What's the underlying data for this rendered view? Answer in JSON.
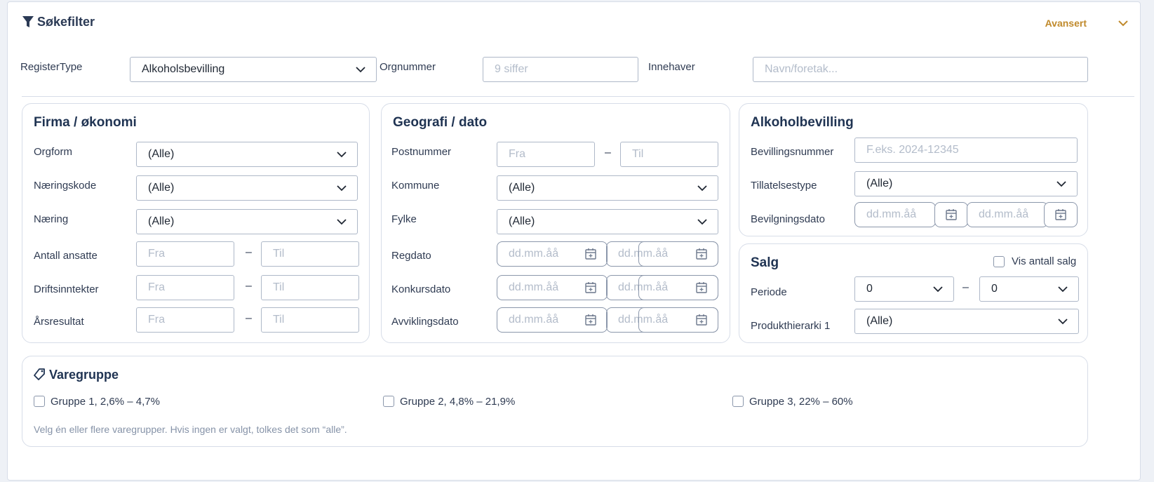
{
  "header": {
    "title": "Søkefilter",
    "advanced_label": "Avansert"
  },
  "top": {
    "registertype_label": "RegisterType",
    "registertype_value": "Alkoholsbevilling",
    "orgnummer_label": "Orgnummer",
    "orgnummer_placeholder": "9 siffer",
    "innehaver_label": "Innehaver",
    "innehaver_placeholder": "Navn/foretak..."
  },
  "firma": {
    "title": "Firma / økonomi",
    "orgform_label": "Orgform",
    "orgform_value": "(Alle)",
    "naeringskode_label": "Næringskode",
    "naeringskode_value": "(Alle)",
    "naering_label": "Næring",
    "naering_value": "(Alle)",
    "ansatte_label": "Antall ansatte",
    "drift_label": "Driftsinntekter",
    "aars_label": "Årsresultat",
    "from_placeholder": "Fra",
    "to_placeholder": "Til",
    "dash": "–"
  },
  "geo": {
    "title": "Geografi / dato",
    "postnummer_label": "Postnummer",
    "kommune_label": "Kommune",
    "kommune_value": "(Alle)",
    "fylke_label": "Fylke",
    "fylke_value": "(Alle)",
    "regdato_label": "Regdato",
    "konkurs_label": "Konkursdato",
    "avvikling_label": "Avviklingsdato",
    "from_placeholder": "Fra",
    "to_placeholder": "Til",
    "date_placeholder": "dd.mm.åå",
    "dash": "–"
  },
  "alkohol": {
    "title": "Alkoholbevilling",
    "bevillingsnummer_label": "Bevillingsnummer",
    "bevillingsnummer_placeholder": "F.eks. 2024-12345",
    "tillatelse_label": "Tillatelsestype",
    "tillatelse_value": "(Alle)",
    "dato_label": "Bevilgningsdato",
    "date_placeholder": "dd.mm.åå"
  },
  "salg": {
    "title": "Salg",
    "vis_label": "Vis antall salg",
    "periode_label": "Periode",
    "periode_from": "0",
    "periode_to": "0",
    "produkt_label": "Produkthierarki 1",
    "produkt_value": "(Alle)",
    "dash": "–"
  },
  "varegruppe": {
    "title": "Varegruppe",
    "groups": [
      "Gruppe 1, 2,6% – 4,7%",
      "Gruppe 2, 4,8% – 21,9%",
      "Gruppe 3, 22% – 60%"
    ],
    "hint": "Velg én eller flere varegrupper. Hvis ingen er valgt, tolkes det som “alle”."
  },
  "icons": [
    "filter-icon",
    "chevron-down-icon",
    "calendar-icon",
    "tag-icon"
  ],
  "colors": {
    "accent": "#c08a2c",
    "title": "#1f3352",
    "border": "#d7dde8"
  }
}
